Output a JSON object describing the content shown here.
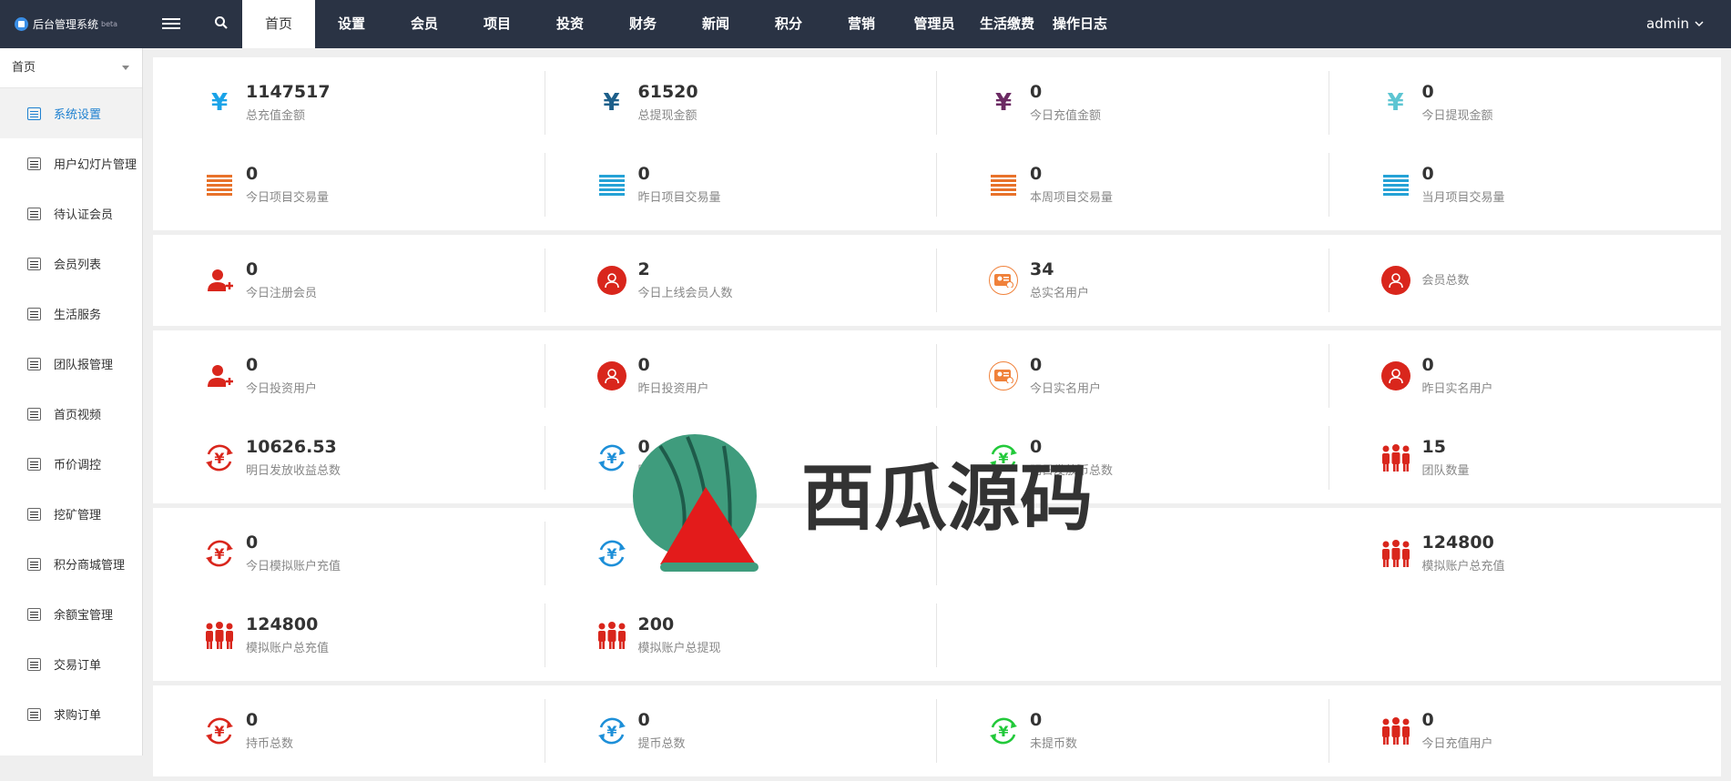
{
  "app": {
    "title": "后台管理系统",
    "badge": "beta"
  },
  "nav": [
    {
      "label": "首页",
      "active": true
    },
    {
      "label": "设置"
    },
    {
      "label": "会员"
    },
    {
      "label": "项目"
    },
    {
      "label": "投资"
    },
    {
      "label": "财务"
    },
    {
      "label": "新闻"
    },
    {
      "label": "积分"
    },
    {
      "label": "营销"
    },
    {
      "label": "管理员"
    },
    {
      "label": "生活缴费"
    },
    {
      "label": "操作日志"
    }
  ],
  "user": {
    "name": "admin"
  },
  "sidebar": {
    "head": "首页",
    "items": [
      {
        "label": "系统设置",
        "active": true
      },
      {
        "label": "用户幻灯片管理"
      },
      {
        "label": "待认证会员"
      },
      {
        "label": "会员列表"
      },
      {
        "label": "生活服务"
      },
      {
        "label": "团队报管理"
      },
      {
        "label": "首页视频"
      },
      {
        "label": "币价调控"
      },
      {
        "label": "挖矿管理"
      },
      {
        "label": "积分商城管理"
      },
      {
        "label": "余额宝管理"
      },
      {
        "label": "交易订单"
      },
      {
        "label": "求购订单"
      }
    ]
  },
  "panels": [
    [
      [
        {
          "icon": "yen",
          "color": "#1aa3e8",
          "value": "1147517",
          "label": "总充值金额"
        },
        {
          "icon": "yen",
          "color": "#1d5f8a",
          "value": "61520",
          "label": "总提现金额"
        },
        {
          "icon": "yen",
          "color": "#6b2a63",
          "value": "0",
          "label": "今日充值金额"
        },
        {
          "icon": "yen",
          "color": "#5cc5d2",
          "value": "0",
          "label": "今日提现金额"
        }
      ],
      [
        {
          "icon": "bars",
          "color": "#e8722a",
          "value": "0",
          "label": "今日项目交易量"
        },
        {
          "icon": "bars",
          "color": "#25a2d6",
          "value": "0",
          "label": "昨日项目交易量"
        },
        {
          "icon": "bars",
          "color": "#e8722a",
          "value": "0",
          "label": "本周项目交易量"
        },
        {
          "icon": "bars",
          "color": "#25a2d6",
          "value": "0",
          "label": "当月项目交易量"
        }
      ]
    ],
    [
      [
        {
          "icon": "user-add",
          "color": "#d9261c",
          "value": "0",
          "label": "今日注册会员"
        },
        {
          "icon": "user-circle",
          "color": "#d9261c",
          "value": "2",
          "label": "今日上线会员人数"
        },
        {
          "icon": "id-card",
          "color": "#f0813a",
          "value": "34",
          "label": "总实名用户"
        },
        {
          "icon": "user-circle",
          "color": "#d9261c",
          "value": "",
          "label": "会员总数"
        }
      ]
    ],
    [
      [
        {
          "icon": "user-add",
          "color": "#d9261c",
          "value": "0",
          "label": "今日投资用户"
        },
        {
          "icon": "user-circle",
          "color": "#d9261c",
          "value": "0",
          "label": "昨日投资用户"
        },
        {
          "icon": "id-card",
          "color": "#f0813a",
          "value": "0",
          "label": "今日实名用户"
        },
        {
          "icon": "user-circle",
          "color": "#d9261c",
          "value": "0",
          "label": "昨日实名用户"
        }
      ],
      [
        {
          "icon": "yen-cycle",
          "color": "#d9261c",
          "value": "10626.53",
          "label": "明日发放收益总数"
        },
        {
          "icon": "yen-cycle",
          "color": "#1d8fd8",
          "value": "0",
          "label": "明日"
        },
        {
          "icon": "yen-cycle",
          "color": "#22c93a",
          "value": "0",
          "label": "明日发放币总数"
        },
        {
          "icon": "team",
          "color": "#d9261c",
          "value": "15",
          "label": "团队数量"
        }
      ]
    ],
    [
      [
        {
          "icon": "yen-cycle",
          "color": "#d9261c",
          "value": "0",
          "label": "今日模拟账户充值"
        },
        {
          "icon": "yen-cycle",
          "color": "#1d8fd8",
          "value": "",
          "label": ""
        },
        {
          "icon": "",
          "color": "",
          "value": "",
          "label": ""
        },
        {
          "icon": "team",
          "color": "#d9261c",
          "value": "124800",
          "label": "模拟账户总充值"
        }
      ],
      [
        {
          "icon": "team",
          "color": "#d9261c",
          "value": "124800",
          "label": "模拟账户总充值"
        },
        {
          "icon": "team",
          "color": "#d9261c",
          "value": "200",
          "label": "模拟账户总提现"
        },
        {
          "icon": "",
          "color": "",
          "value": "",
          "label": ""
        },
        {
          "icon": "",
          "color": "",
          "value": "",
          "label": ""
        }
      ]
    ],
    [
      [
        {
          "icon": "yen-cycle",
          "color": "#d9261c",
          "value": "0",
          "label": "持币总数"
        },
        {
          "icon": "yen-cycle",
          "color": "#1d8fd8",
          "value": "0",
          "label": "提币总数"
        },
        {
          "icon": "yen-cycle",
          "color": "#22c93a",
          "value": "0",
          "label": "未提币数"
        },
        {
          "icon": "team",
          "color": "#d9261c",
          "value": "0",
          "label": "今日充值用户"
        }
      ]
    ]
  ]
}
